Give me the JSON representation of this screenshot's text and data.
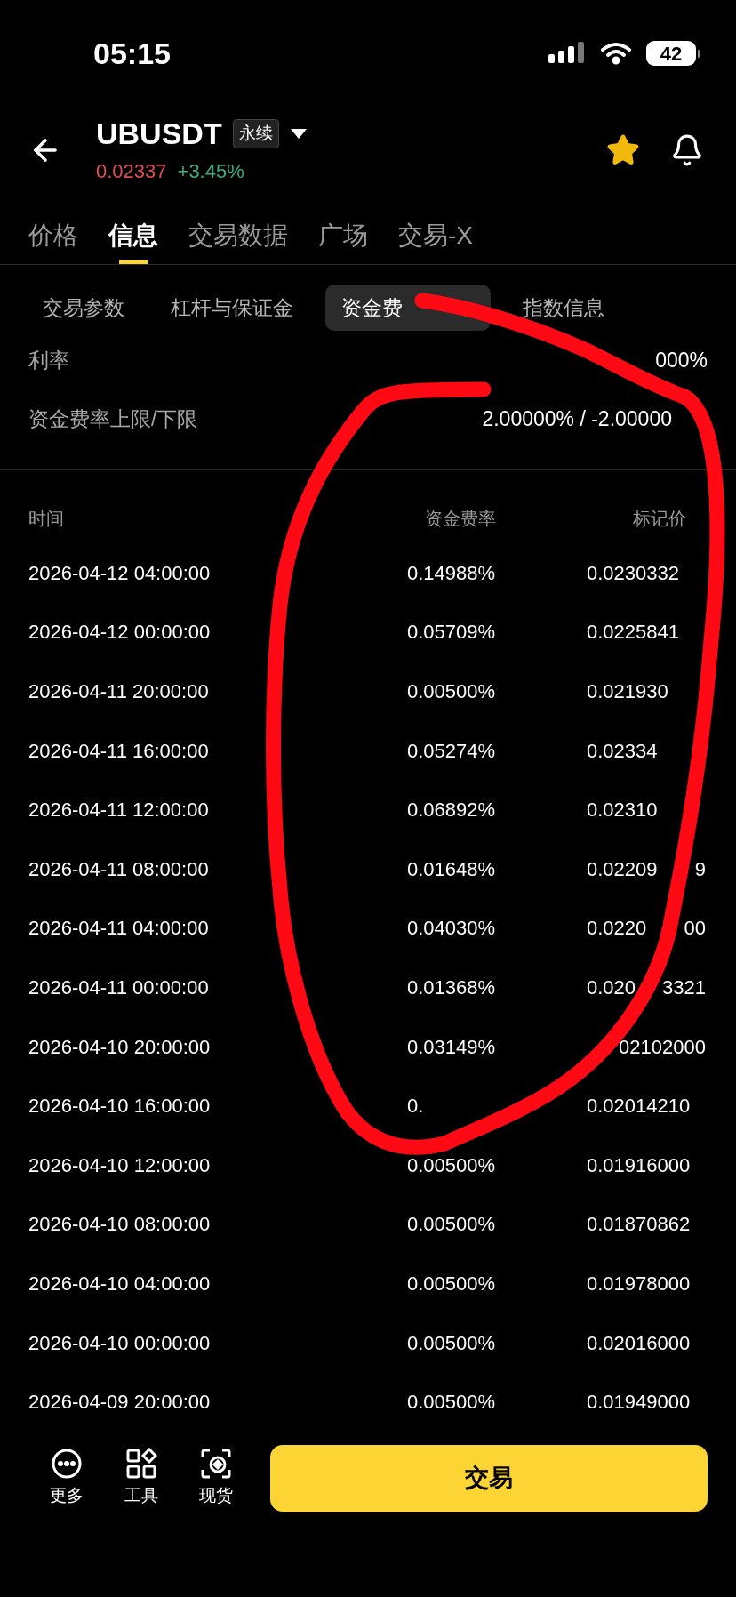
{
  "status_bar": {
    "time": "05:15",
    "battery": "42"
  },
  "header": {
    "symbol": "UBUSDT",
    "badge": "永续",
    "price": "0.02337",
    "change": "+3.45%",
    "favorite": true
  },
  "tabs": [
    {
      "label": "价格",
      "selected": false
    },
    {
      "label": "信息",
      "selected": true
    },
    {
      "label": "交易数据",
      "selected": false
    },
    {
      "label": "广场",
      "selected": false
    },
    {
      "label": "交易-X",
      "selected": false
    }
  ],
  "subtabs": [
    {
      "label": "交易参数",
      "selected": false
    },
    {
      "label": "杠杆与保证金",
      "selected": false
    },
    {
      "label": "资金费",
      "selected": true
    },
    {
      "label": "指数信息",
      "selected": false
    }
  ],
  "info_rows": [
    {
      "label": "利率",
      "value": "000%"
    },
    {
      "label": "资金费率上限/下限",
      "value": "2.00000% / -2.00000"
    }
  ],
  "table": {
    "columns": [
      "时间",
      "资金费率",
      "标记价"
    ],
    "rows": [
      {
        "time": "2026-04-12 04:00:00",
        "rate": "0.14988%",
        "mark": "0.0230332"
      },
      {
        "time": "2026-04-12 00:00:00",
        "rate": "0.05709%",
        "mark": "0.0225841"
      },
      {
        "time": "2026-04-11 20:00:00",
        "rate": "0.00500%",
        "mark": "0.021930"
      },
      {
        "time": "2026-04-11 16:00:00",
        "rate": "0.05274%",
        "mark": "0.02334"
      },
      {
        "time": "2026-04-11 12:00:00",
        "rate": "0.06892%",
        "mark": "0.02310"
      },
      {
        "time": "2026-04-11 08:00:00",
        "rate": "0.01648%",
        "mark": "0.02209",
        "mark_tail": "9"
      },
      {
        "time": "2026-04-11 04:00:00",
        "rate": "0.04030%",
        "mark": "0.0220",
        "mark_tail": "00"
      },
      {
        "time": "2026-04-11 00:00:00",
        "rate": "0.01368%",
        "mark": "0.020",
        "mark_tail": "3321"
      },
      {
        "time": "2026-04-10 20:00:00",
        "rate": "0.03149%",
        "mark_tail": "02102000"
      },
      {
        "time": "2026-04-10 16:00:00",
        "rate": "0.",
        "mark": "0.02014210"
      },
      {
        "time": "2026-04-10 12:00:00",
        "rate": "0.00500%",
        "mark": "0.01916000"
      },
      {
        "time": "2026-04-10 08:00:00",
        "rate": "0.00500%",
        "mark": "0.01870862"
      },
      {
        "time": "2026-04-10 04:00:00",
        "rate": "0.00500%",
        "mark": "0.01978000"
      },
      {
        "time": "2026-04-10 00:00:00",
        "rate": "0.00500%",
        "mark": "0.02016000"
      },
      {
        "time": "2026-04-09 20:00:00",
        "rate": "0.00500%",
        "mark": "0.01949000"
      }
    ]
  },
  "bottom_bar": {
    "items": [
      {
        "kind": "more",
        "label": "更多"
      },
      {
        "kind": "tools",
        "label": "工具"
      },
      {
        "kind": "spot",
        "label": "现货"
      }
    ],
    "trade_button": "交易"
  }
}
